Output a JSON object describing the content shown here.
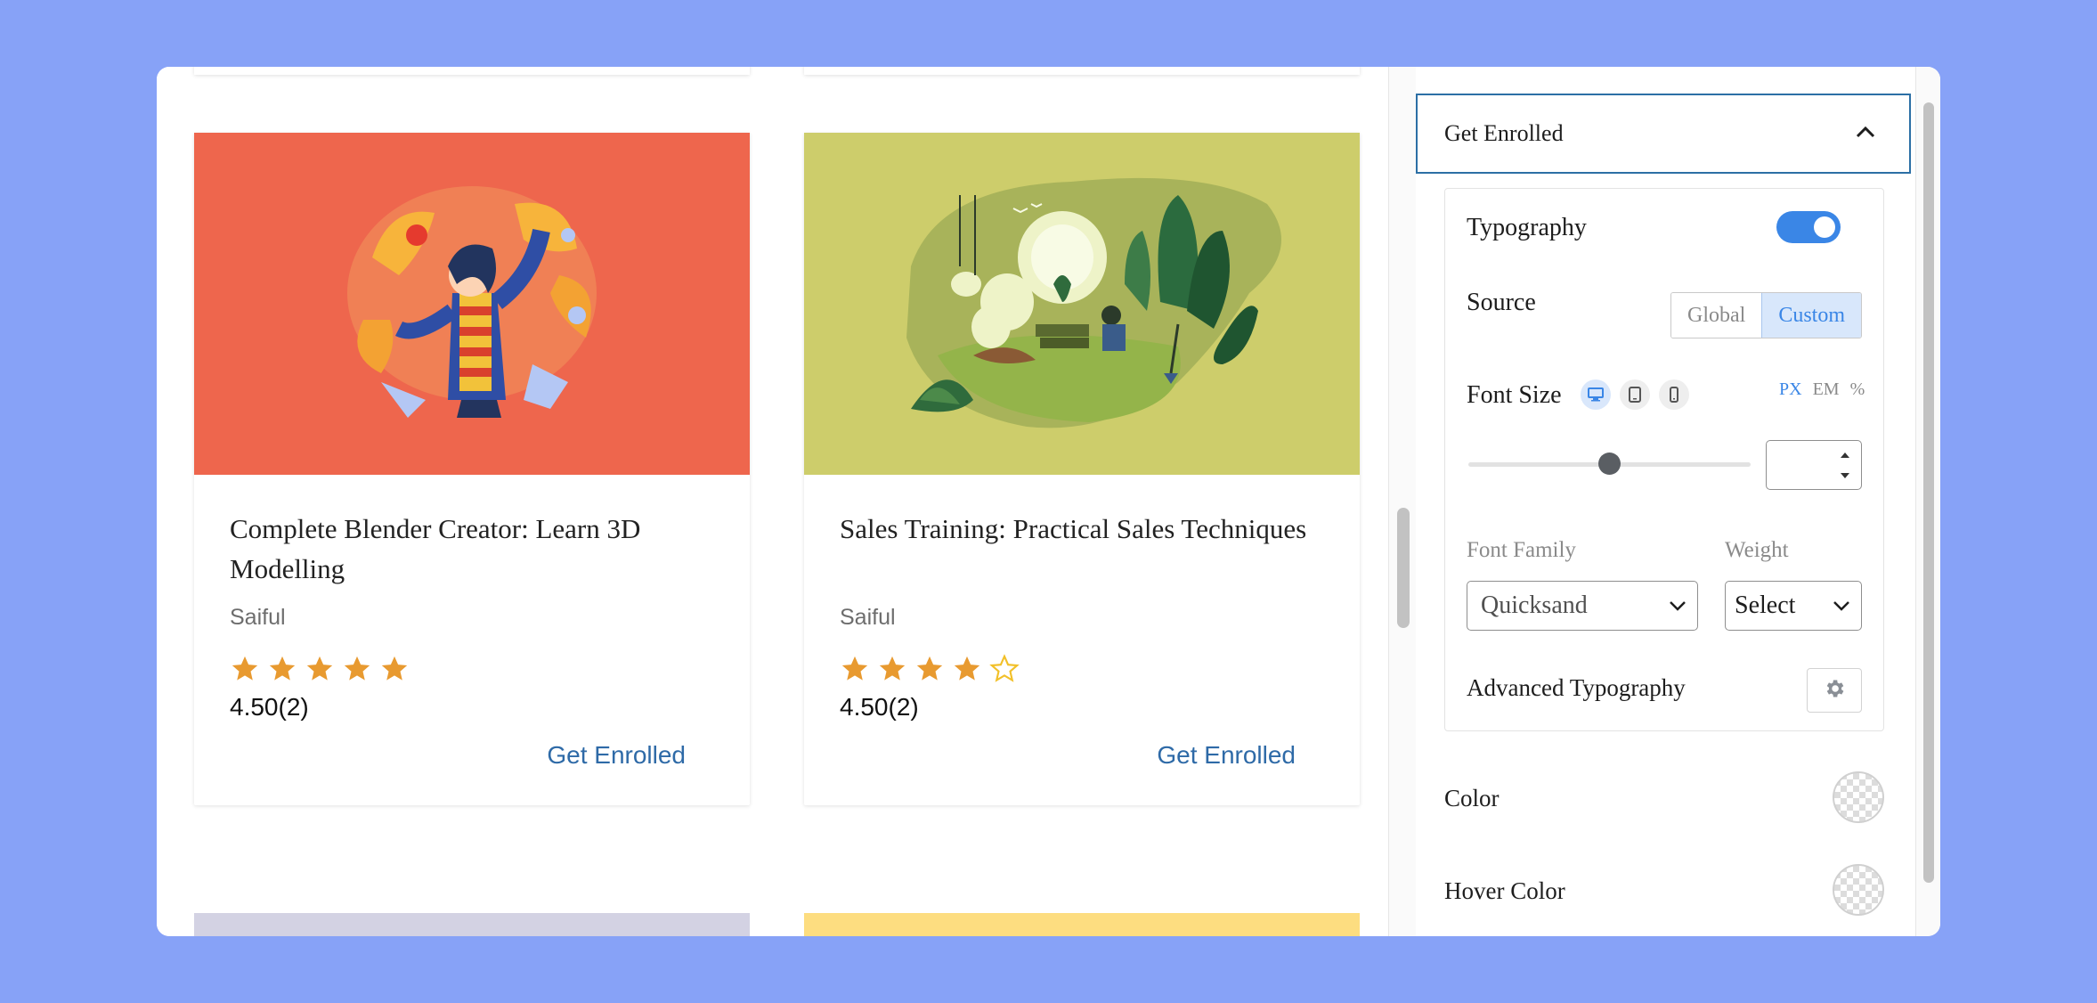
{
  "courses": [
    {
      "title": "Complete Blender Creator: Learn 3D Modelling",
      "author": "Saiful",
      "rating_text": "4.50(2)",
      "stars_filled": 5,
      "stars_total": 5,
      "cta": "Get Enrolled",
      "thumb_color": "#ee664d"
    },
    {
      "title": "Sales Training: Practical Sales Techniques",
      "author": "Saiful",
      "rating_text": "4.50(2)",
      "stars_filled": 4,
      "stars_total": 5,
      "cta": "Get Enrolled",
      "thumb_color": "#cdcd6b"
    }
  ],
  "below_cards": [
    {
      "thumb_color": "#d3d2e3"
    },
    {
      "thumb_color": "#fddd80"
    }
  ],
  "panel": {
    "section_title": "Get Enrolled",
    "typography_label": "Typography",
    "typography_enabled": true,
    "source_label": "Source",
    "source_options": [
      "Global",
      "Custom"
    ],
    "source_selected": "Custom",
    "font_size_label": "Font Size",
    "devices": [
      "desktop-icon",
      "tablet-icon",
      "mobile-icon"
    ],
    "units": [
      "PX",
      "EM",
      "%"
    ],
    "unit_selected": "PX",
    "font_size_value": "",
    "font_family_label": "Font Family",
    "font_family_value": "Quicksand",
    "weight_label": "Weight",
    "weight_value": "Select",
    "advanced_label": "Advanced Typography",
    "color_label": "Color",
    "hover_color_label": "Hover Color"
  },
  "colors": {
    "accent": "#3a86e6",
    "link": "#2e6aa7",
    "star": "#e89a30",
    "background": "#87a2f7"
  }
}
